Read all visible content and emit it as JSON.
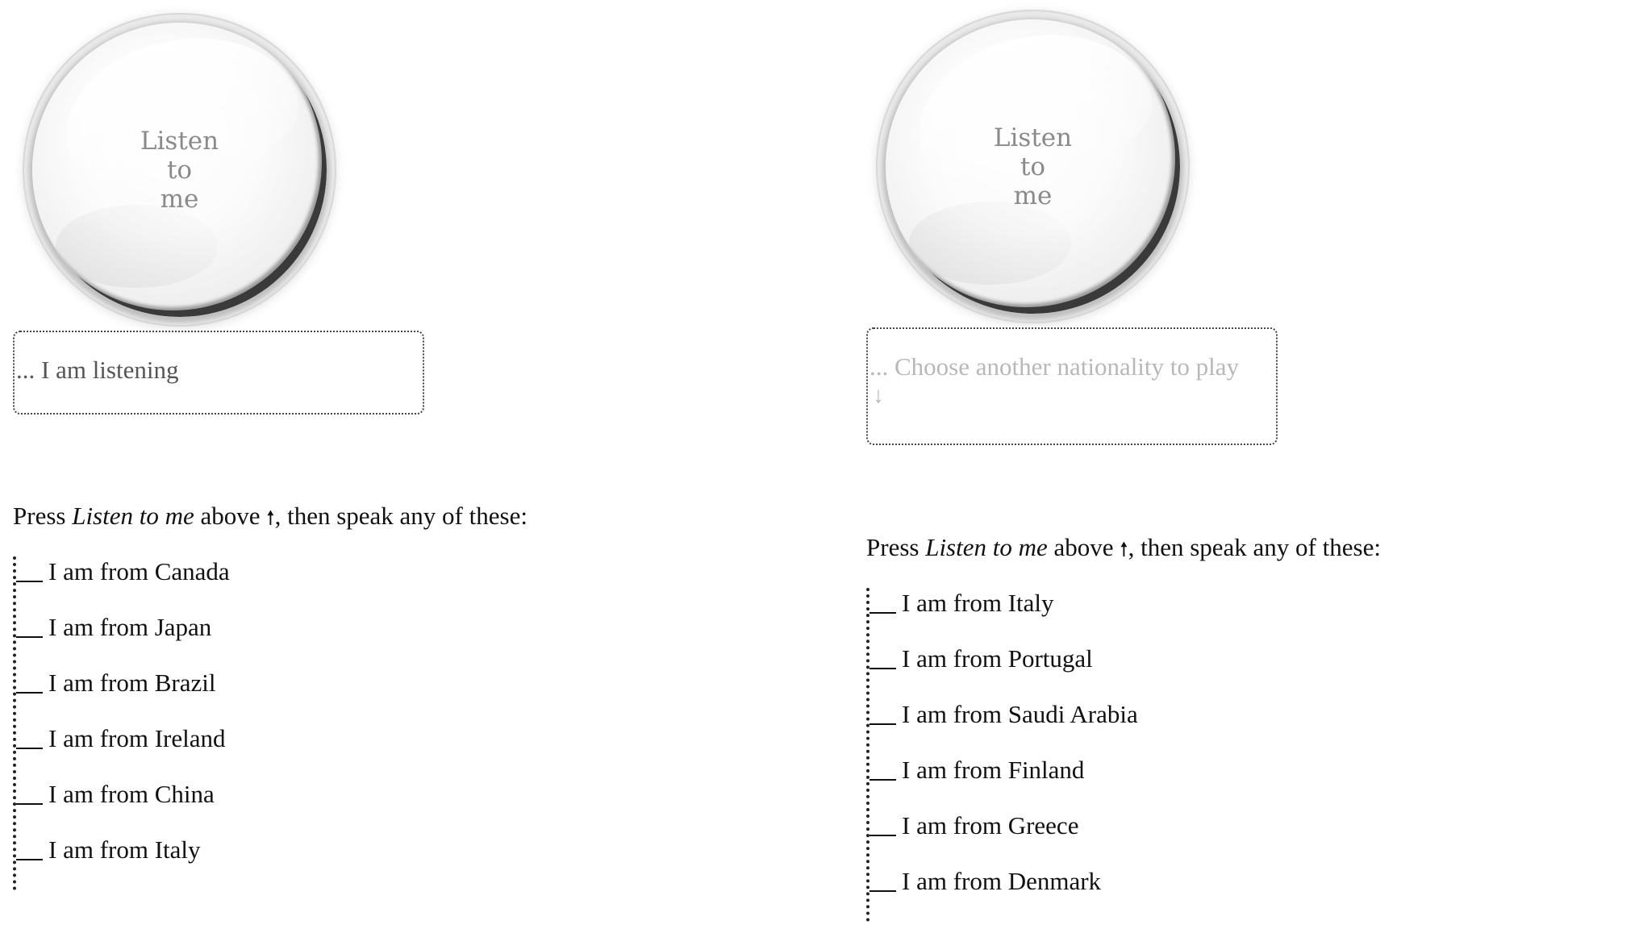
{
  "panels": [
    {
      "button_label": [
        "Listen",
        "to",
        "me"
      ],
      "status_text": "... I am listening",
      "status_arrow": "",
      "instructions": {
        "prefix": "Press ",
        "emphasis": "Listen to me",
        "middle": " above ",
        "arrow": "🠕",
        "suffix": ", then speak any of these:"
      },
      "phrases": [
        "I am from Canada",
        "I am from Japan",
        "I am from Brazil",
        "I am from Ireland",
        "I am from China",
        "I am from Italy"
      ]
    },
    {
      "button_label": [
        "Listen",
        "to",
        "me"
      ],
      "status_text": "... Choose another nationality to play",
      "status_arrow": "↓",
      "instructions": {
        "prefix": "Press ",
        "emphasis": "Listen to me",
        "middle": " above ",
        "arrow": "🠕",
        "suffix": ", then speak any of these:"
      },
      "phrases": [
        "I am from Italy",
        "I am from Portugal",
        "I am from Saudi Arabia",
        "I am from Finland",
        "I am from Greece",
        "I am from Denmark"
      ]
    }
  ]
}
